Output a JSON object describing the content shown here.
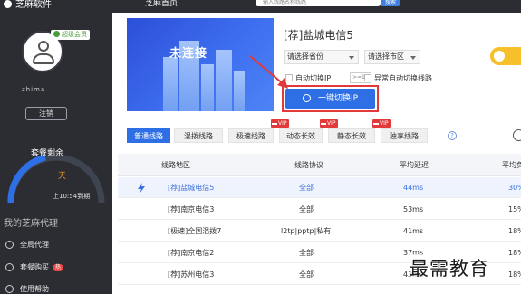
{
  "app": {
    "name": "芝麻软件"
  },
  "topbar": {
    "tab_home": "芝麻首页",
    "search_placeholder": "输入线路名称线路",
    "search_button": "搜索"
  },
  "user": {
    "vip_label": "超级会员",
    "username": "zhima",
    "logout_label": "注销"
  },
  "plan": {
    "title": "套餐剩余",
    "days_unit": "天",
    "expire_text": "上10:54到期",
    "gauge_color": "#2f6fe6"
  },
  "sidebar": {
    "section_title": "我的芝麻代理",
    "items": [
      {
        "label": "全局代理",
        "icon": "globe-icon",
        "badge": ""
      },
      {
        "label": "套餐购买",
        "icon": "cart-icon",
        "badge": "hot"
      },
      {
        "label": "使用帮助",
        "icon": "help-icon",
        "badge": ""
      }
    ]
  },
  "hero": {
    "status": "未连接"
  },
  "connection": {
    "line_title": "[荐]盐城电信5",
    "province_select": "请选择省份",
    "city_select": "请选择市区",
    "auto_switch_label": "自动切换IP",
    "interval_placeholder": ">=10s",
    "abnormal_switch_label": "异常自动切换线路",
    "switch_button": "一键切换IP"
  },
  "tabs": [
    {
      "label": "普通线路",
      "vip": false,
      "active": true
    },
    {
      "label": "混拨线路",
      "vip": false,
      "active": false
    },
    {
      "label": "极速线路",
      "vip": false,
      "active": false
    },
    {
      "label": "动态长效",
      "vip": true,
      "active": false
    },
    {
      "label": "静态长效",
      "vip": true,
      "active": false
    },
    {
      "label": "独享线路",
      "vip": true,
      "active": false
    }
  ],
  "vip_tag_text": "VIP",
  "help_mark": "?",
  "table": {
    "columns": [
      "线路地区",
      "线路协议",
      "平均延迟",
      "平均负"
    ],
    "rows": [
      {
        "region": "[荐]盐城电信5",
        "protocol": "全部",
        "latency": "44ms",
        "load": "30%",
        "selected": true
      },
      {
        "region": "[荐]南京电信3",
        "protocol": "全部",
        "latency": "53ms",
        "load": "15%",
        "selected": false
      },
      {
        "region": "[极速]全国混拨7",
        "protocol": "l2tp|pptp|私有",
        "latency": "41ms",
        "load": "18%",
        "selected": false
      },
      {
        "region": "[荐]南京电信2",
        "protocol": "全部",
        "latency": "37ms",
        "load": "18%",
        "selected": false
      },
      {
        "region": "[荐]苏州电信3",
        "protocol": "全部",
        "latency": "43ms",
        "load": "18%",
        "selected": false
      }
    ]
  },
  "watermark": "最需教育"
}
